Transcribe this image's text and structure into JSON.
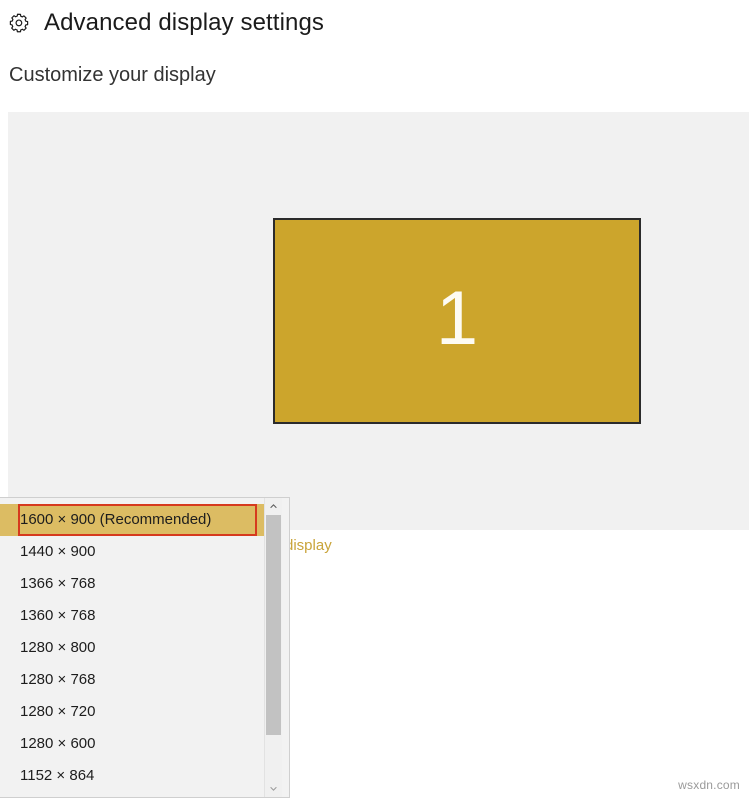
{
  "header": {
    "icon": "gear-icon",
    "title": "Advanced display settings"
  },
  "section": {
    "heading": "Customize your display"
  },
  "preview": {
    "monitor_label": "1",
    "monitor_color": "#cca52c",
    "panel_color": "#f1f1f1"
  },
  "resolution": {
    "caption": "display",
    "caption_color": "#c9a43a",
    "selected": "1600 × 900 (Recommended)",
    "highlight_color": "#dcbc63",
    "annotation_color": "#d63a1e",
    "options": [
      "1600 × 900 (Recommended)",
      "1440 × 900",
      "1366 × 768",
      "1360 × 768",
      "1280 × 800",
      "1280 × 768",
      "1280 × 720",
      "1280 × 600",
      "1152 × 864"
    ],
    "scroll_up_icon": "chevron-up-icon",
    "scroll_down_icon": "chevron-down-icon"
  },
  "watermark": {
    "text": "wsxdn.com"
  }
}
